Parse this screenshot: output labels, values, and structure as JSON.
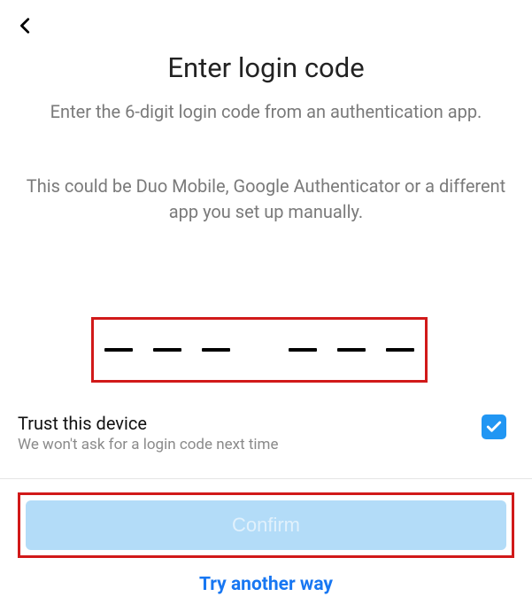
{
  "title": "Enter login code",
  "subtitle": "Enter the 6-digit login code from an authentication app.",
  "helptext": "This could be Duo Mobile, Google Authenticator or a different app you set up manually.",
  "code_digits": 6,
  "trust": {
    "label": "Trust this device",
    "sub": "We won't ask for a login code next time",
    "checked": true
  },
  "confirm_label": "Confirm",
  "alt_link_label": "Try another way",
  "colors": {
    "accent_blue": "#1877f2",
    "checkbox_blue": "#2196f3",
    "confirm_bg": "#b3dcf8",
    "highlight_red": "#d11919"
  },
  "highlights": [
    "code-input",
    "confirm-button"
  ]
}
